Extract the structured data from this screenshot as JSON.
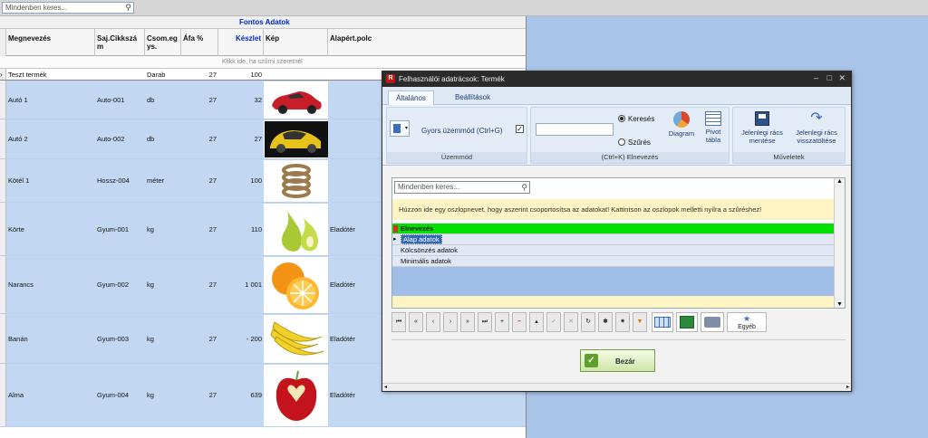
{
  "top_search": {
    "placeholder": "Mindenben keres..."
  },
  "grid": {
    "band_title": "Fontos Adatok",
    "columns": [
      "Megnevezés",
      "Saj.Cikkszá m",
      "Csom.eg ys.",
      "Áfa %",
      "Készlet",
      "Kép",
      "Alapért.polc"
    ],
    "filter_hint": "Klikk ide, ha szűrni szeretnél",
    "rows": [
      {
        "name": "Teszt termék",
        "code": "",
        "unit": "Darab",
        "vat": "27",
        "stock": "100",
        "image": "",
        "shelf": ""
      },
      {
        "name": "Autó 1",
        "code": "Auto-001",
        "unit": "db",
        "vat": "27",
        "stock": "32",
        "image": "red-car",
        "shelf": ""
      },
      {
        "name": "Autó 2",
        "code": "Auto-002",
        "unit": "db",
        "vat": "27",
        "stock": "27",
        "image": "yellow-car",
        "shelf": ""
      },
      {
        "name": "Kötél 1",
        "code": "Hossz-004",
        "unit": "méter",
        "vat": "27",
        "stock": "100",
        "image": "rope",
        "shelf": ""
      },
      {
        "name": "Körte",
        "code": "Gyum-001",
        "unit": "kg",
        "vat": "27",
        "stock": "110",
        "image": "pear",
        "shelf": "Eladótér"
      },
      {
        "name": "Narancs",
        "code": "Gyum-002",
        "unit": "kg",
        "vat": "27",
        "stock": "1 001",
        "image": "orange",
        "shelf": "Eladótér"
      },
      {
        "name": "Banán",
        "code": "Gyum-003",
        "unit": "kg",
        "vat": "27",
        "stock": "- 200",
        "image": "banana",
        "shelf": "Eladótér"
      },
      {
        "name": "Alma",
        "code": "Gyum-004",
        "unit": "kg",
        "vat": "27",
        "stock": "639",
        "image": "apple",
        "shelf": "Eladótér"
      }
    ]
  },
  "dialog": {
    "title": "Felhasználói adatrácsok: Termék",
    "tabs": [
      "Általános",
      "Beállítások"
    ],
    "quick_mode_label": "Gyors üzemmód (Ctrl+G)",
    "group_mode": "Üzemmód",
    "radio_search": "Keresés",
    "radio_filter": "Szűrés",
    "diagram": "Diagram",
    "pivot": "Pivot tábla",
    "group_naming": "(Ctrl+K) Elnevezés",
    "save_grid": "Jelenlegi rács mentése",
    "reload_grid": "Jelenlegi rács visszatöltése",
    "group_ops": "Műveletek",
    "inner_search_placeholder": "Mindenben keres...",
    "group_hint": "Húzzon ide egy oszlopnevet, hogy aszerint csoportosítsa az adatokat! Kattintson az oszlopok melletti nyílra a szűréshez!",
    "list_header": "Elnevezés",
    "list_items": [
      "Alap adatok",
      "Kölcsönzés adatok",
      "Minimális adatok"
    ],
    "other_button": "Egyéb",
    "close_button": "Bezár"
  },
  "colors": {
    "grid_row": "#c2d8f2",
    "header_green": "#00e000",
    "accent_blue": "#0026d6"
  }
}
